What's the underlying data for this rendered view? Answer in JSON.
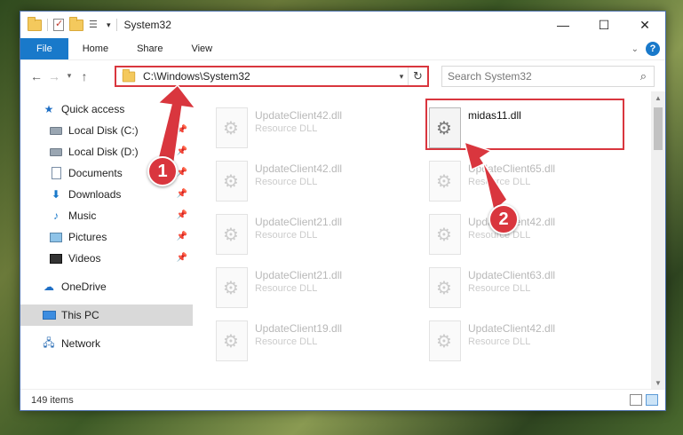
{
  "window": {
    "title": "System32",
    "controls": {
      "minimize": "—",
      "maximize": "☐",
      "close": "✕"
    }
  },
  "ribbon": {
    "tabs": [
      "File",
      "Home",
      "Share",
      "View"
    ],
    "help": "?"
  },
  "navbar": {
    "back": "←",
    "forward": "→",
    "recent": "▾",
    "up": "↑",
    "address": "C:\\Windows\\System32",
    "search_placeholder": "Search System32"
  },
  "sidebar": {
    "quick_access": "Quick access",
    "pinned": [
      {
        "label": "Local Disk (C:)",
        "icon": "drive-icon"
      },
      {
        "label": "Local Disk (D:)",
        "icon": "drive-icon"
      },
      {
        "label": "Documents",
        "icon": "documents-icon"
      },
      {
        "label": "Downloads",
        "icon": "downloads-icon"
      },
      {
        "label": "Music",
        "icon": "music-icon"
      },
      {
        "label": "Pictures",
        "icon": "pictures-icon"
      },
      {
        "label": "Videos",
        "icon": "videos-icon"
      }
    ],
    "onedrive": "OneDrive",
    "this_pc": "This PC",
    "network": "Network"
  },
  "files": [
    {
      "name": "UpdateClient42.dll",
      "type": "Resource DLL"
    },
    {
      "name": "midas11.dll",
      "type": ""
    },
    {
      "name": "UpdateClient42.dll",
      "type": "Resource DLL"
    },
    {
      "name": "UpdateClient65.dll",
      "type": "Resource DLL"
    },
    {
      "name": "UpdateClient21.dll",
      "type": "Resource DLL"
    },
    {
      "name": "UpdateClient42.dll",
      "type": "Resource DLL"
    },
    {
      "name": "UpdateClient21.dll",
      "type": "Resource DLL"
    },
    {
      "name": "UpdateClient63.dll",
      "type": "Resource DLL"
    },
    {
      "name": "UpdateClient19.dll",
      "type": "Resource DLL"
    },
    {
      "name": "UpdateClient42.dll",
      "type": "Resource DLL"
    }
  ],
  "status": {
    "item_count": "149 items"
  },
  "annotations": {
    "step1": "1",
    "step2": "2",
    "color": "#d9363e"
  }
}
